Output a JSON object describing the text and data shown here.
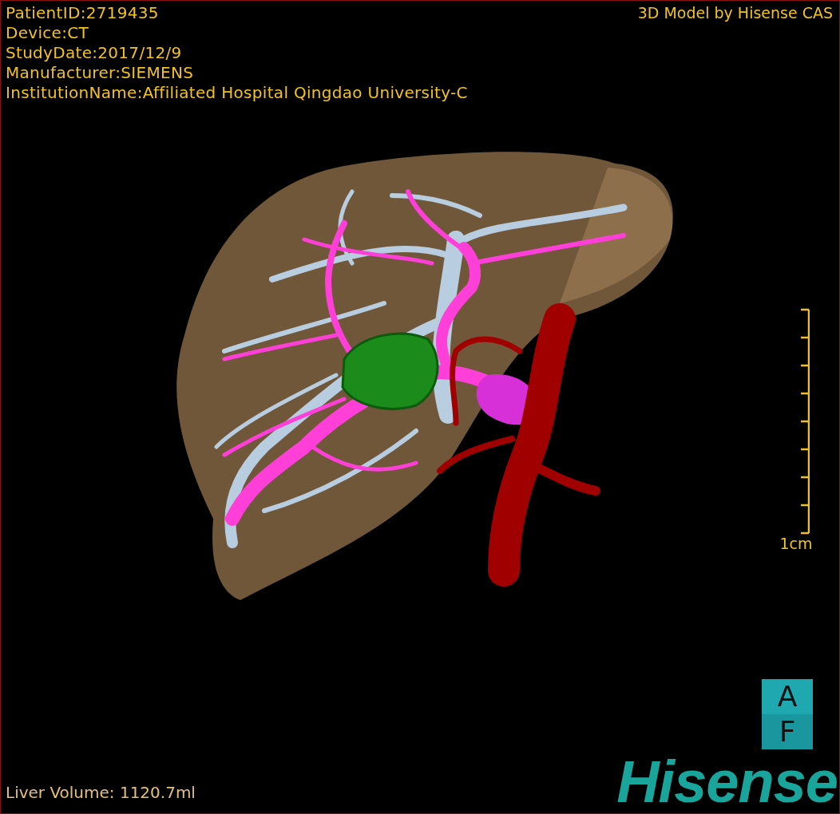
{
  "header": {
    "patient_info": [
      "PatientID:2719435",
      "Device:CT",
      "StudyDate:2017/12/9",
      "Manufacturer:SIEMENS",
      "InstitutionName:Affiliated Hospital Qingdao University-C"
    ],
    "credit": "3D Model by Hisense CAS"
  },
  "scale_bar": {
    "label": "1cm"
  },
  "orientation_marker": {
    "labels": [
      "A",
      "F"
    ]
  },
  "footer": {
    "liver_volume": "Liver Volume: 1120.7ml"
  },
  "logo": {
    "text": "Hisense"
  }
}
